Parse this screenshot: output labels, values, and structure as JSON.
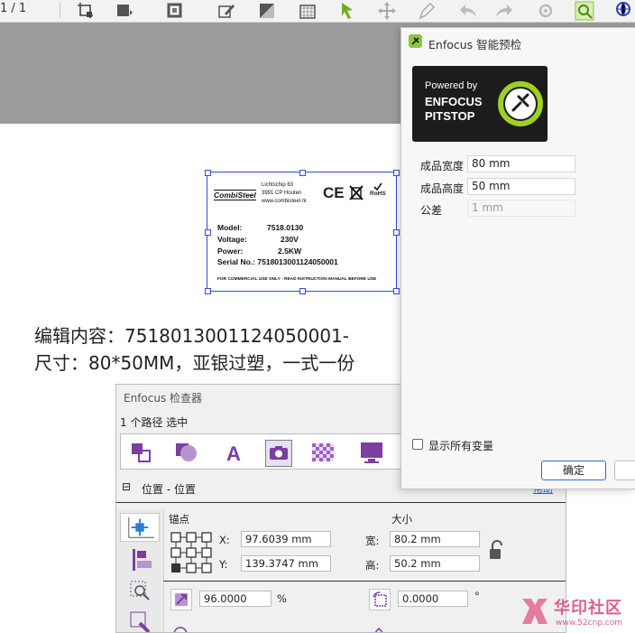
{
  "toolbar": {
    "page_indicator": "1 / 1",
    "icons": [
      "crop-icon",
      "fill-icon",
      "stroke-icon",
      "pen-edit-icon",
      "convert-icon",
      "transparency-icon",
      "select-arrow-icon",
      "move-icon",
      "pen-icon",
      "undo-icon",
      "redo-icon",
      "settings-icon",
      "zoom-icon",
      "globe-icon"
    ]
  },
  "label": {
    "brand": "CombiSteel",
    "address_line1": "Lichtschip 63",
    "address_line2": "3991 CP Houten",
    "address_line3": "www.combisteel.nl",
    "ce": "CE",
    "rohs": "RoHS",
    "rows": [
      {
        "key": "Model:",
        "value": "7518.0130"
      },
      {
        "key": "Voltage:",
        "value": "230V"
      },
      {
        "key": "Power:",
        "value": "2.5KW"
      }
    ],
    "serial": "Serial No.: 7518013001124050001",
    "footer": "FOR COMMERCIAL USE ONLY - READ INSTRUCTION MANUAL BEFORE USE"
  },
  "edit_content": {
    "line1": "编辑内容：7518013001124050001-",
    "line2": "尺寸：80*50MM，亚银过塑，一式一份"
  },
  "inspector": {
    "title": "Enfocus 检查器",
    "selection": "1 个路径 选中",
    "section_toggle": "⊟",
    "section_label": "位置 - 位置",
    "section_link": "帮助",
    "anchor_label": "锚点",
    "size_label": "大小",
    "x_label": "X:",
    "x_value": "97.6039 mm",
    "y_label": "Y:",
    "y_value": "139.3747 mm",
    "width_label": "宽:",
    "width_value": "80.2 mm",
    "height_label": "高:",
    "height_value": "50.2 mm",
    "scale_value": "96.0000",
    "scale_unit": "%",
    "rotate_value": "0.0000",
    "rotate_unit": "°"
  },
  "preflight": {
    "title": "Enfocus 智能预检",
    "logo_line1": "Powered by",
    "logo_line2": "ENFOCUS",
    "logo_line3": "PITSTOP",
    "width_label": "成品宽度",
    "width_value": "80 mm",
    "height_label": "成品高度",
    "height_value": "50 mm",
    "tolerance_label": "公差",
    "tolerance_value": "1 mm",
    "show_all_label": "显示所有变量",
    "ok_label": "确定"
  },
  "watermark": {
    "site": "华印社区",
    "url": "www.52cnp.com"
  },
  "colors": {
    "selection": "#3c4ad8",
    "icon_purple": "#7b3fa0",
    "logo_green": "#9fd022",
    "ok_border": "#2a6bd8"
  }
}
